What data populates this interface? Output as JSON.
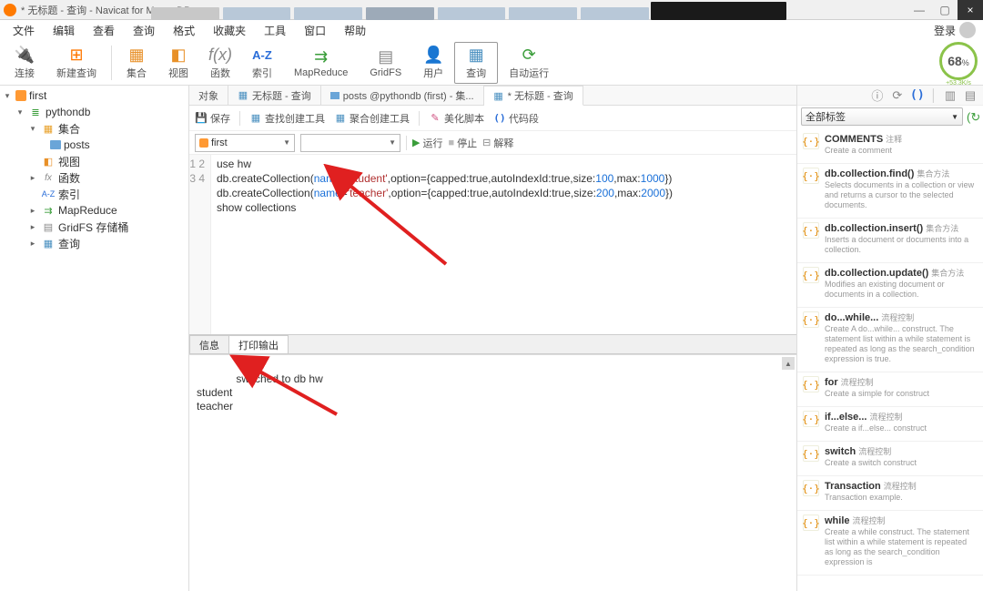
{
  "window": {
    "title": "* 无标题 - 查询 - Navicat for MongoDB",
    "min": "—",
    "max": "▢",
    "close": "×"
  },
  "menu": {
    "items": [
      "文件",
      "编辑",
      "查看",
      "查询",
      "格式",
      "收藏夹",
      "工具",
      "窗口",
      "帮助"
    ],
    "login": "登录"
  },
  "ribbon": {
    "connect": "连接",
    "newquery": "新建查询",
    "collection": "集合",
    "view": "视图",
    "function": "函数",
    "index": "索引",
    "mapreduce": "MapReduce",
    "gridfs": "GridFS",
    "user": "用户",
    "query": "查询",
    "autorun": "自动运行",
    "gauge_pct": "68",
    "gauge_unit": "%",
    "gauge_sub": "+53.3K/s"
  },
  "tree": {
    "root": "first",
    "db": "pythondb",
    "collections": "集合",
    "posts": "posts",
    "views": "视图",
    "functions": "函数",
    "indexes": "索引",
    "mapreduce": "MapReduce",
    "gridfs": "GridFS 存储桶",
    "queries": "查询"
  },
  "tabs": {
    "objects": "对象",
    "untitled1": "无标题 - 查询",
    "posts": "posts @pythondb (first) - 集...",
    "untitled2": "* 无标题 - 查询"
  },
  "toolbar": {
    "save": "保存",
    "findbuild": "查找创建工具",
    "aggbuild": "聚合创建工具",
    "beautify": "美化脚本",
    "snippet": "代码段"
  },
  "runbar": {
    "combo1": "first",
    "combo2": "",
    "run": "运行",
    "stop": "停止",
    "explain": "解释"
  },
  "code": {
    "line1": "use hw",
    "l2a": "db.createCollection(",
    "l2name": "name",
    "l2eq": "=",
    "l2str": "'student'",
    "l2b": ",option={capped:",
    "l2true1": "true",
    "l2c": ",autoIndexId:",
    "l2true2": "true",
    "l2d": ",size:",
    "l2n1": "100",
    "l2e": ",max:",
    "l2n2": "1000",
    "l2f": "})",
    "l3str": "'teacher'",
    "l3n1": "200",
    "l3n2": "2000",
    "line4": "show collections"
  },
  "bottom_tabs": {
    "info": "信息",
    "print": "打印输出"
  },
  "output": {
    "l1": "switched to db hw",
    "l2": "student",
    "l3": "teacher"
  },
  "right": {
    "filter": "全部标签",
    "items": [
      {
        "title": "COMMENTS",
        "tag": "注释",
        "desc": "Create a comment"
      },
      {
        "title": "db.collection.find()",
        "tag": "集合方法",
        "desc": "Selects documents in a collection or view and returns a cursor to the selected documents."
      },
      {
        "title": "db.collection.insert()",
        "tag": "集合方法",
        "desc": "Inserts a document or documents into a collection."
      },
      {
        "title": "db.collection.update()",
        "tag": "集合方法",
        "desc": "Modifies an existing document or documents in a collection."
      },
      {
        "title": "do...while...",
        "tag": "流程控制",
        "desc": "Create A do...while... construct. The statement list within a while statement is repeated as long as the search_condition expression is true."
      },
      {
        "title": "for",
        "tag": "流程控制",
        "desc": "Create a simple for construct"
      },
      {
        "title": "if...else...",
        "tag": "流程控制",
        "desc": "Create a if...else... construct"
      },
      {
        "title": "switch",
        "tag": "流程控制",
        "desc": "Create a switch construct"
      },
      {
        "title": "Transaction",
        "tag": "流程控制",
        "desc": "Transaction example."
      },
      {
        "title": "while",
        "tag": "流程控制",
        "desc": "Create a while construct. The statement list within a while statement is repeated as long as the search_condition expression is"
      }
    ]
  }
}
